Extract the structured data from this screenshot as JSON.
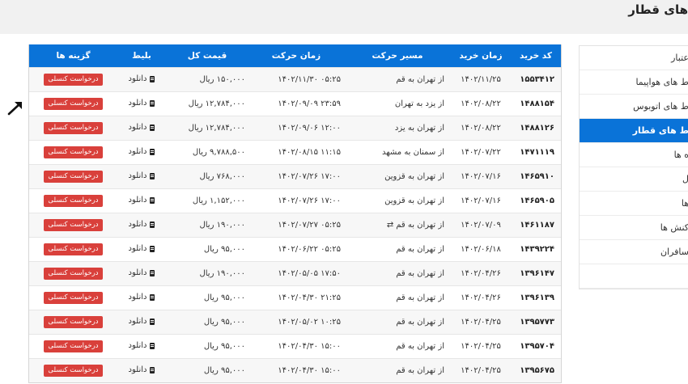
{
  "page": {
    "title": "های قطار"
  },
  "sidebar": {
    "items": [
      {
        "label": "عتبار",
        "active": false
      },
      {
        "label": "ط های هواپیما",
        "active": false
      },
      {
        "label": "ط های اتوبوس",
        "active": false
      },
      {
        "label": "ط های قطار",
        "active": true
      },
      {
        "label": "ه ها",
        "active": false
      },
      {
        "label": "ل",
        "active": false
      },
      {
        "label": "ها",
        "active": false
      },
      {
        "label": "کنش ها",
        "active": false
      },
      {
        "label": "سافران",
        "active": false
      },
      {
        "label": "",
        "active": false
      }
    ]
  },
  "table": {
    "headers": {
      "code": "کد خرید",
      "purchase_time": "زمان خرید",
      "route": "مسیر حرکت",
      "depart_time": "زمان حرکت",
      "price": "قیمت کل",
      "ticket": "بلیط",
      "options": "گزینه ها"
    },
    "download_label": "دانلود",
    "cancel_label": "درخواست کنسلی",
    "rows": [
      {
        "code": "۱۵۵۳۴۱۲",
        "purchase_time": "۱۴۰۲/۱۱/۲۵",
        "route": "از تهران به قم",
        "depart_time": "۰۵:۲۵ ۱۴۰۲/۱۱/۳۰",
        "price": "۱۵۰,۰۰۰ ریال",
        "swap": false
      },
      {
        "code": "۱۴۸۸۱۵۴",
        "purchase_time": "۱۴۰۲/۰۸/۲۲",
        "route": "از یزد به تهران",
        "depart_time": "۲۳:۵۹ ۱۴۰۲/۰۹/۰۹",
        "price": "۱۲,۷۸۴,۰۰۰ ریال",
        "swap": false
      },
      {
        "code": "۱۴۸۸۱۲۶",
        "purchase_time": "۱۴۰۲/۰۸/۲۲",
        "route": "از تهران به یزد",
        "depart_time": "۱۲:۰۰ ۱۴۰۲/۰۹/۰۶",
        "price": "۱۲,۷۸۴,۰۰۰ ریال",
        "swap": false
      },
      {
        "code": "۱۴۷۱۱۱۹",
        "purchase_time": "۱۴۰۲/۰۷/۲۲",
        "route": "از سمنان به مشهد",
        "depart_time": "۱۱:۱۵ ۱۴۰۲/۰۸/۱۵",
        "price": "۹,۷۸۸,۵۰۰ ریال",
        "swap": false
      },
      {
        "code": "۱۴۶۵۹۱۰",
        "purchase_time": "۱۴۰۲/۰۷/۱۶",
        "route": "از تهران به قزوین",
        "depart_time": "۱۷:۰۰ ۱۴۰۲/۰۷/۲۶",
        "price": "۷۶۸,۰۰۰ ریال",
        "swap": false
      },
      {
        "code": "۱۴۶۵۹۰۵",
        "purchase_time": "۱۴۰۲/۰۷/۱۶",
        "route": "از تهران به قزوین",
        "depart_time": "۱۷:۰۰ ۱۴۰۲/۰۷/۲۶",
        "price": "۱,۱۵۲,۰۰۰ ریال",
        "swap": false
      },
      {
        "code": "۱۴۶۱۱۸۷",
        "purchase_time": "۱۴۰۲/۰۷/۰۹",
        "route": "از تهران به قم",
        "depart_time": "۰۵:۲۵ ۱۴۰۲/۰۷/۲۷",
        "price": "۱۹۰,۰۰۰ ریال",
        "swap": true
      },
      {
        "code": "۱۴۳۹۲۲۴",
        "purchase_time": "۱۴۰۲/۰۶/۱۸",
        "route": "از تهران به قم",
        "depart_time": "۰۵:۲۵ ۱۴۰۲/۰۶/۲۲",
        "price": "۹۵,۰۰۰ ریال",
        "swap": false
      },
      {
        "code": "۱۳۹۶۱۴۷",
        "purchase_time": "۱۴۰۲/۰۴/۲۶",
        "route": "از تهران به قم",
        "depart_time": "۱۷:۵۰ ۱۴۰۲/۰۵/۰۵",
        "price": "۱۹۰,۰۰۰ ریال",
        "swap": false
      },
      {
        "code": "۱۳۹۶۱۳۹",
        "purchase_time": "۱۴۰۲/۰۴/۲۶",
        "route": "از تهران به قم",
        "depart_time": "۲۱:۲۵ ۱۴۰۲/۰۴/۳۰",
        "price": "۹۵,۰۰۰ ریال",
        "swap": false
      },
      {
        "code": "۱۳۹۵۷۷۳",
        "purchase_time": "۱۴۰۲/۰۴/۲۵",
        "route": "از تهران به قم",
        "depart_time": "۱۰:۲۵ ۱۴۰۲/۰۵/۰۲",
        "price": "۹۵,۰۰۰ ریال",
        "swap": false
      },
      {
        "code": "۱۳۹۵۷۰۴",
        "purchase_time": "۱۴۰۲/۰۴/۲۵",
        "route": "از تهران به قم",
        "depart_time": "۱۵:۰۰ ۱۴۰۲/۰۴/۳۰",
        "price": "۹۵,۰۰۰ ریال",
        "swap": false
      },
      {
        "code": "۱۳۹۵۶۷۵",
        "purchase_time": "۱۴۰۲/۰۴/۲۵",
        "route": "از تهران به قم",
        "depart_time": "۱۵:۰۰ ۱۴۰۲/۰۴/۳۰",
        "price": "۹۵,۰۰۰ ریال",
        "swap": false
      }
    ]
  },
  "icons": {
    "download": "document-icon",
    "swap": "swap-arrows-icon",
    "cursor": "mouse-cursor-icon"
  },
  "colors": {
    "header_bg": "#0a73d8",
    "active_item": "#0a73d8",
    "cancel_button": "#d9403b"
  }
}
